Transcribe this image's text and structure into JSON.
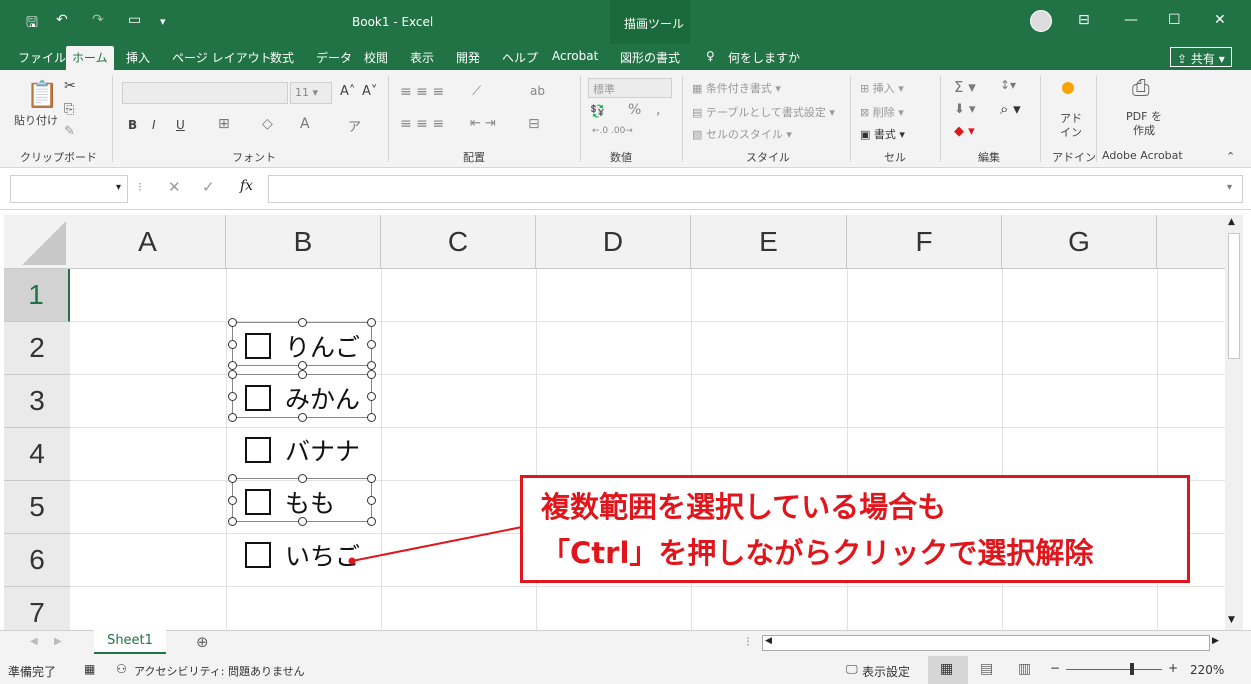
{
  "window": {
    "title": "Book1  -  Excel",
    "context_tab": "描画ツール"
  },
  "ribbon_tabs": [
    "ファイル",
    "ホーム",
    "挿入",
    "ページ レイアウト",
    "数式",
    "データ",
    "校閲",
    "表示",
    "開発",
    "ヘルプ",
    "Acrobat",
    "図形の書式"
  ],
  "tell_me": "何をしますか",
  "share": "共有",
  "ribbon": {
    "clipboard": {
      "paste": "貼り付け",
      "label": "クリップボード"
    },
    "font": {
      "size": "11",
      "label": "フォント",
      "bold": "B",
      "italic": "I",
      "underline": "U"
    },
    "alignment": {
      "label": "配置"
    },
    "number": {
      "format": "標準",
      "label": "数値",
      "percent": "%"
    },
    "styles": {
      "cond": "条件付き書式",
      "table": "テーブルとして書式設定",
      "cell": "セルのスタイル",
      "label": "スタイル"
    },
    "cells": {
      "insert": "挿入",
      "delete": "削除",
      "format": "書式",
      "label": "セル"
    },
    "editing": {
      "label": "編集"
    },
    "addin": {
      "name": "アド イン",
      "label": "アドイン"
    },
    "acrobat": {
      "name": "PDF を作成",
      "label": "Adobe Acrobat"
    }
  },
  "formula_bar": {
    "fx": "fx",
    "content": ""
  },
  "columns": [
    "A",
    "B",
    "C",
    "D",
    "E",
    "F",
    "G"
  ],
  "rows": [
    "1",
    "2",
    "3",
    "4",
    "5",
    "6",
    "7"
  ],
  "checkboxes": [
    {
      "label": "りんご",
      "selected": true
    },
    {
      "label": "みかん",
      "selected": true
    },
    {
      "label": "バナナ",
      "selected": false
    },
    {
      "label": "もも",
      "selected": true
    },
    {
      "label": "いちご",
      "selected": false
    }
  ],
  "callout": {
    "line1": "複数範囲を選択している場合も",
    "line2": "「Ctrl」を押しながらクリックで選択解除",
    "color": "#e0161c"
  },
  "sheet_tab": "Sheet1",
  "status": {
    "ready": "準備完了",
    "accessibility": "アクセシビリティ: 問題ありません",
    "display_settings": "表示設定",
    "zoom": "220%"
  },
  "colors": {
    "excel_green": "#217346"
  }
}
